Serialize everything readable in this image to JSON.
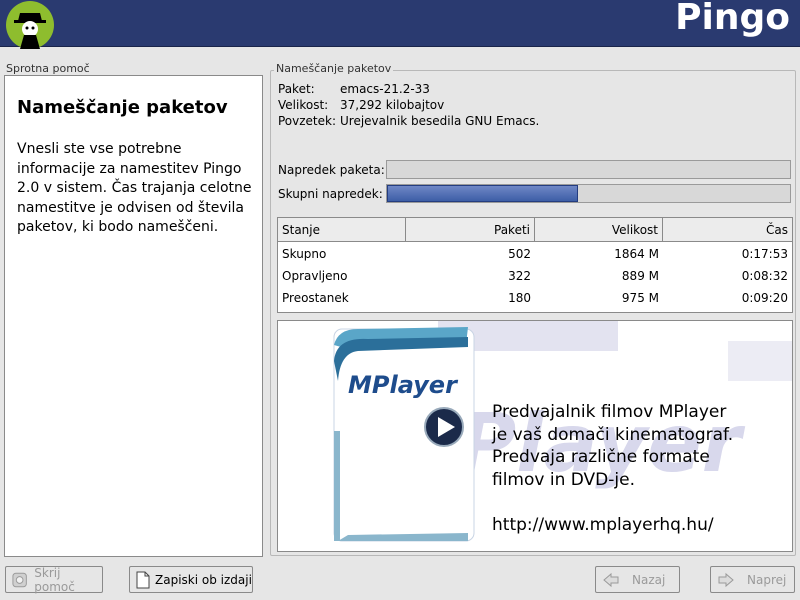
{
  "header": {
    "brand": "Pingo"
  },
  "help": {
    "label": "Sprotna pomoč",
    "title": "Nameščanje paketov",
    "body": "Vnesli ste vse potrebne informacije za namestitev Pingo 2.0 v sistem. Čas trajanja celotne namestitve je odvisen od števila paketov, ki bodo nameščeni."
  },
  "install": {
    "group_label": "Nameščanje paketov",
    "info": [
      {
        "key": "Paket:",
        "value": "emacs-21.2-33"
      },
      {
        "key": "Velikost:",
        "value": "37,292 kilobajtov"
      },
      {
        "key": "Povzetek:",
        "value": "Urejevalnik besedila GNU Emacs."
      }
    ],
    "package_progress_label": "Napredek paketa:",
    "total_progress_label": "Skupni napredek:",
    "package_progress": 0.0,
    "total_progress": 0.475
  },
  "table": {
    "headers": [
      "Stanje",
      "Paketi",
      "Velikost",
      "Čas"
    ],
    "rows": [
      [
        "Skupno",
        "502",
        "1864 M",
        "0:17:53"
      ],
      [
        "Opravljeno",
        "322",
        "889 M",
        "0:08:32"
      ],
      [
        "Preostanek",
        "180",
        "975 M",
        "0:09:20"
      ]
    ]
  },
  "banner": {
    "logo_text": "MPlayer",
    "lines": [
      "Predvajalnik filmov MPlayer",
      "je vaš domači kinematograf.",
      "Predvaja različne formate",
      "filmov in DVD-je.",
      "",
      "http://www.mplayerhq.hu/"
    ]
  },
  "buttons": {
    "hide_help": "Skrij pomoč",
    "release_notes": "Zapiski ob izdaji",
    "back": "Nazaj",
    "next": "Naprej"
  }
}
